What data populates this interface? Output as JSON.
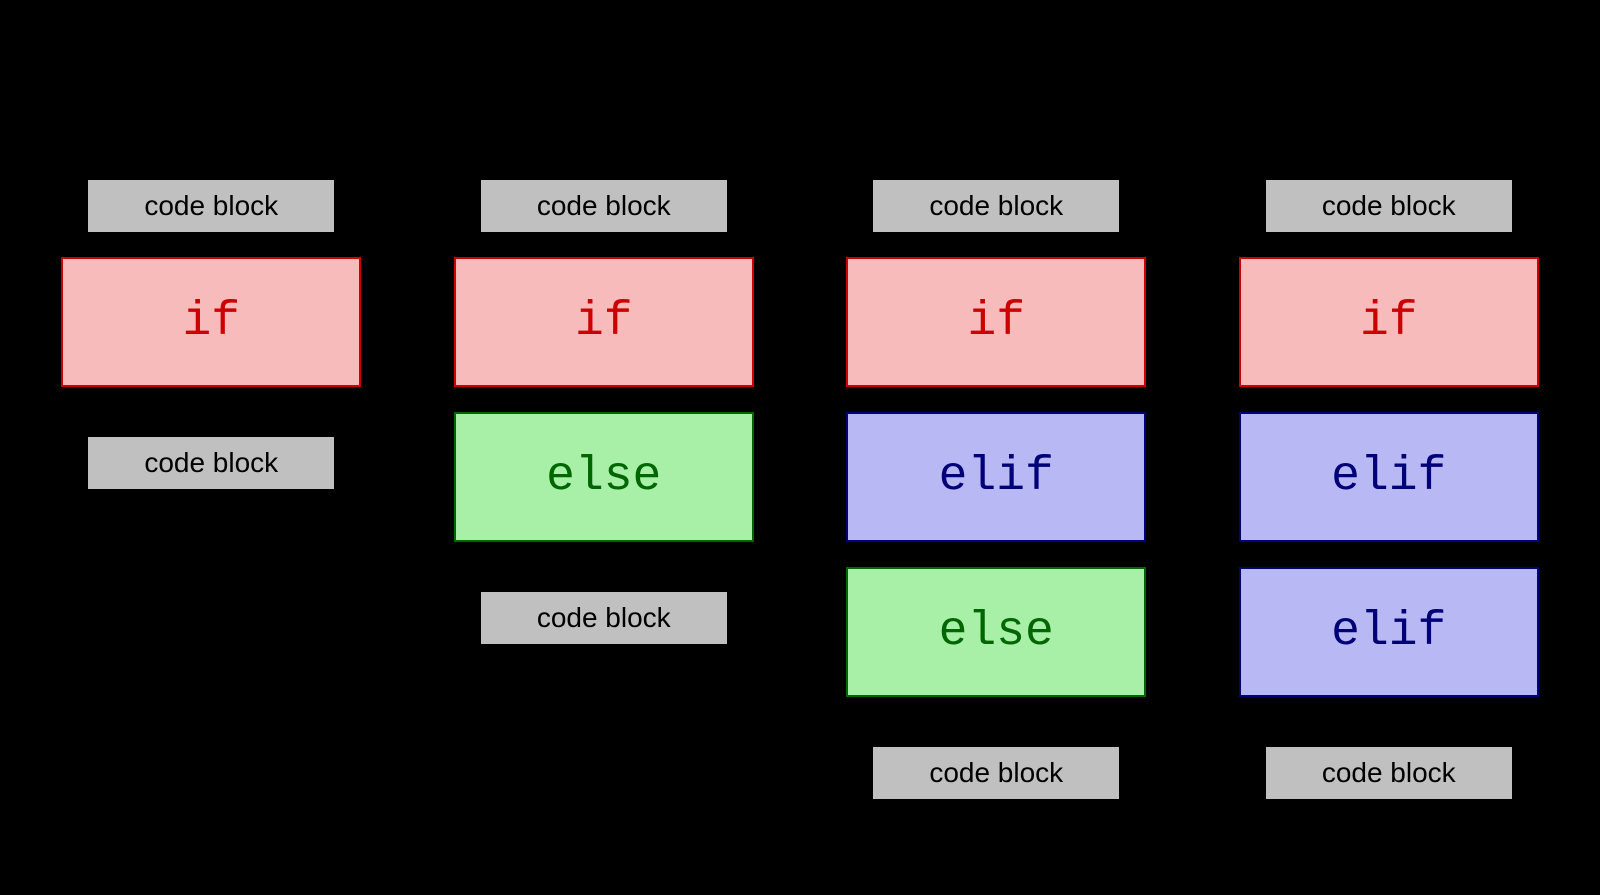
{
  "labels": {
    "code_block": "code block",
    "if": "if",
    "else": "else",
    "elif": "elif"
  },
  "columns": [
    {
      "before": true,
      "blocks": [
        "if"
      ],
      "after": true
    },
    {
      "before": true,
      "blocks": [
        "if",
        "else"
      ],
      "after": true
    },
    {
      "before": true,
      "blocks": [
        "if",
        "elif",
        "else"
      ],
      "after": true
    },
    {
      "before": true,
      "blocks": [
        "if",
        "elif",
        "elif"
      ],
      "after": true
    }
  ]
}
